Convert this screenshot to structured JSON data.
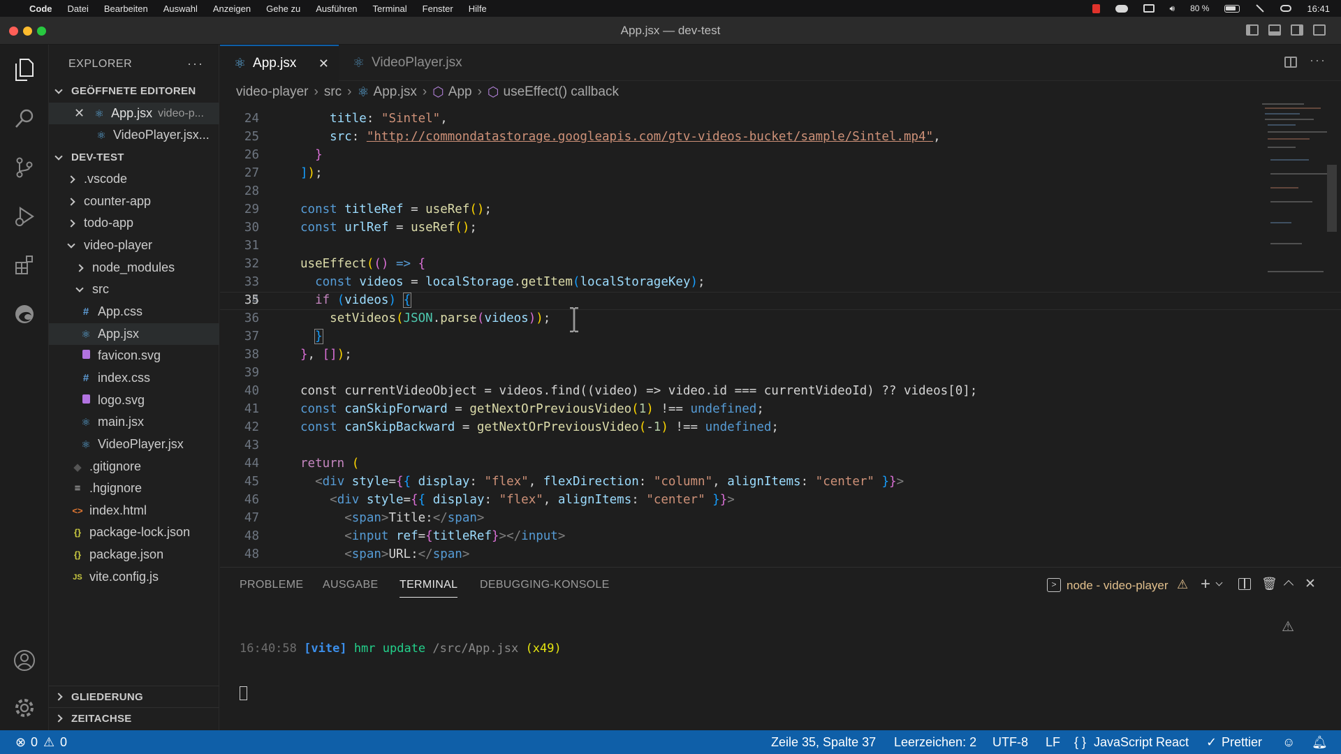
{
  "menubar": {
    "app": "Code",
    "items": [
      "Datei",
      "Bearbeiten",
      "Auswahl",
      "Anzeigen",
      "Gehe zu",
      "Ausführen",
      "Terminal",
      "Fenster",
      "Hilfe"
    ],
    "battery": "80 %",
    "clock": "16:41"
  },
  "window": {
    "title": "App.jsx — dev-test"
  },
  "sidebar": {
    "header": "EXPLORER",
    "open_editors": {
      "label": "GEÖFFNETE EDITOREN",
      "items": [
        {
          "name": "App.jsx",
          "path": "video-p..."
        },
        {
          "name": "VideoPlayer.jsx..."
        }
      ]
    },
    "workspace": "DEV-TEST",
    "tree": [
      {
        "label": ".vscode",
        "icon": "›"
      },
      {
        "label": "counter-app"
      },
      {
        "label": "todo-app"
      },
      {
        "label": "video-player"
      },
      {
        "label": "node_modules"
      },
      {
        "label": "src"
      },
      {
        "label": "App.css",
        "icon": "#"
      },
      {
        "label": "App.jsx",
        "icon": "⚛"
      },
      {
        "label": "favicon.svg"
      },
      {
        "label": "index.css",
        "icon": "#"
      },
      {
        "label": "logo.svg"
      },
      {
        "label": "main.jsx",
        "icon": "⚛"
      },
      {
        "label": "VideoPlayer.jsx",
        "icon": "⚛"
      },
      {
        "label": ".gitignore"
      },
      {
        "label": ".hgignore",
        "icon": "≡"
      },
      {
        "label": "index.html",
        "icon": "<>"
      },
      {
        "label": "package-lock.json",
        "icon": "{}"
      },
      {
        "label": "package.json",
        "icon": "{}"
      },
      {
        "label": "vite.config.js",
        "icon": "JS"
      }
    ],
    "outline": "GLIEDERUNG",
    "timeline": "ZEITACHSE"
  },
  "tabs": [
    {
      "label": "App.jsx",
      "active": true
    },
    {
      "label": "VideoPlayer.jsx",
      "active": false
    }
  ],
  "breadcrumb": [
    "video-player",
    "src",
    "App.jsx",
    "App",
    "useEffect() callback"
  ],
  "editor": {
    "current_line": 35,
    "line_numbers": [
      "24",
      "25",
      "26",
      "27",
      "28",
      "29",
      "30",
      "31",
      "32",
      "33",
      "34",
      "35",
      "36",
      "37",
      "38",
      "39",
      "40",
      "41",
      "42",
      "43",
      "44",
      "45",
      "46",
      "47",
      "48"
    ],
    "code": {
      "l24": "title: \"Sintel\",",
      "url": "\"http://commondatastorage.googleapis.com/gtv-videos-bucket/sample/Sintel.mp4\"",
      "l39": "const currentVideoObject = videos.find((video) => video.id === currentVideoId) ?? videos[0];"
    }
  },
  "panel": {
    "tabs": [
      "PROBLEME",
      "AUSGABE",
      "TERMINAL",
      "DEBUGGING-KONSOLE"
    ],
    "active_tab": "TERMINAL",
    "terminal_name": "node - video-player",
    "output": {
      "time": "16:40:58",
      "tag": "[vite]",
      "msg": "hmr update",
      "file": "/src/App.jsx",
      "count": "(x49)"
    }
  },
  "statusbar": {
    "errors": "0",
    "warnings": "0",
    "position": "Zeile 35, Spalte 37",
    "indent": "Leerzeichen: 2",
    "encoding": "UTF-8",
    "eol": "LF",
    "language": "JavaScript React",
    "formatter": "Prettier"
  },
  "colors": {
    "accent": "#0f5fa8",
    "editor_bg": "#1e1e1e",
    "sidebar_bg": "#1f1f1f"
  }
}
